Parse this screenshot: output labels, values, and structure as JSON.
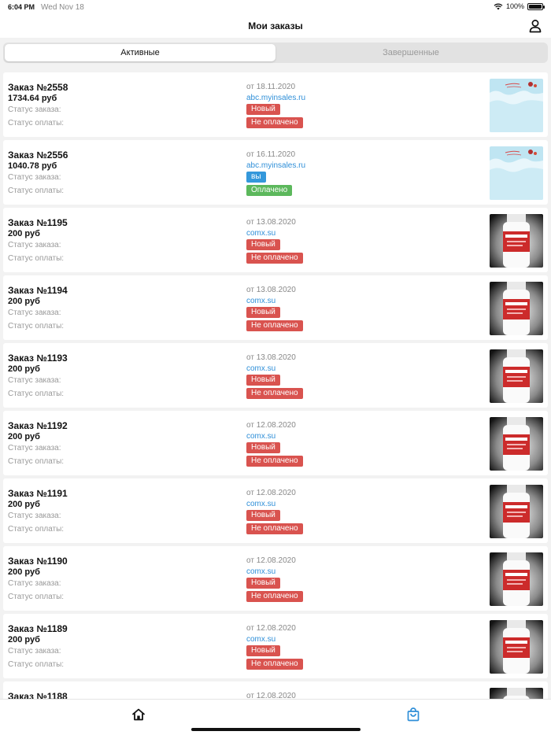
{
  "status_bar": {
    "time": "6:04 PM",
    "date": "Wed Nov 18",
    "battery": "100%"
  },
  "header": {
    "title": "Мои заказы"
  },
  "segments": {
    "active": "Активные",
    "completed": "Завершенные"
  },
  "labels": {
    "order_status": "Статус заказа:",
    "payment_status": "Статус оплаты:"
  },
  "orders": [
    {
      "number": "Заказ №2558",
      "price": "1734.64 руб",
      "date": "от 18.11.2020",
      "shop": "abc.myinsales.ru",
      "status": "Новый",
      "status_color": "#d9534f",
      "payment": "Не оплачено",
      "payment_color": "#d9534f",
      "image": "holiday-banner"
    },
    {
      "number": "Заказ №2556",
      "price": "1040.78 руб",
      "date": "от 16.11.2020",
      "shop": "abc.myinsales.ru",
      "status": "вы",
      "status_color": "#3498db",
      "payment": "Оплачено",
      "payment_color": "#5cb85c",
      "image": "holiday-banner"
    },
    {
      "number": "Заказ №1195",
      "price": "200 руб",
      "date": "от 13.08.2020",
      "shop": "comx.su",
      "status": "Новый",
      "status_color": "#d9534f",
      "payment": "Не оплачено",
      "payment_color": "#d9534f",
      "image": "bottle"
    },
    {
      "number": "Заказ №1194",
      "price": "200 руб",
      "date": "от 13.08.2020",
      "shop": "comx.su",
      "status": "Новый",
      "status_color": "#d9534f",
      "payment": "Не оплачено",
      "payment_color": "#d9534f",
      "image": "bottle"
    },
    {
      "number": "Заказ №1193",
      "price": "200 руб",
      "date": "от 13.08.2020",
      "shop": "comx.su",
      "status": "Новый",
      "status_color": "#d9534f",
      "payment": "Не оплачено",
      "payment_color": "#d9534f",
      "image": "bottle"
    },
    {
      "number": "Заказ №1192",
      "price": "200 руб",
      "date": "от 12.08.2020",
      "shop": "comx.su",
      "status": "Новый",
      "status_color": "#d9534f",
      "payment": "Не оплачено",
      "payment_color": "#d9534f",
      "image": "bottle"
    },
    {
      "number": "Заказ №1191",
      "price": "200 руб",
      "date": "от 12.08.2020",
      "shop": "comx.su",
      "status": "Новый",
      "status_color": "#d9534f",
      "payment": "Не оплачено",
      "payment_color": "#d9534f",
      "image": "bottle"
    },
    {
      "number": "Заказ №1190",
      "price": "200 руб",
      "date": "от 12.08.2020",
      "shop": "comx.su",
      "status": "Новый",
      "status_color": "#d9534f",
      "payment": "Не оплачено",
      "payment_color": "#d9534f",
      "image": "bottle"
    },
    {
      "number": "Заказ №1189",
      "price": "200 руб",
      "date": "от 12.08.2020",
      "shop": "comx.su",
      "status": "Новый",
      "status_color": "#d9534f",
      "payment": "Не оплачено",
      "payment_color": "#d9534f",
      "image": "bottle"
    },
    {
      "number": "Заказ №1188",
      "price": "",
      "date": "от 12.08.2020",
      "shop": "",
      "status": "",
      "status_color": "#d9534f",
      "payment": "",
      "payment_color": "#d9534f",
      "image": "bottle"
    }
  ],
  "tab_bar": {
    "home_icon": "home-icon",
    "orders_icon": "shopping-bag-icon",
    "active_color": "#2f8fd8"
  }
}
